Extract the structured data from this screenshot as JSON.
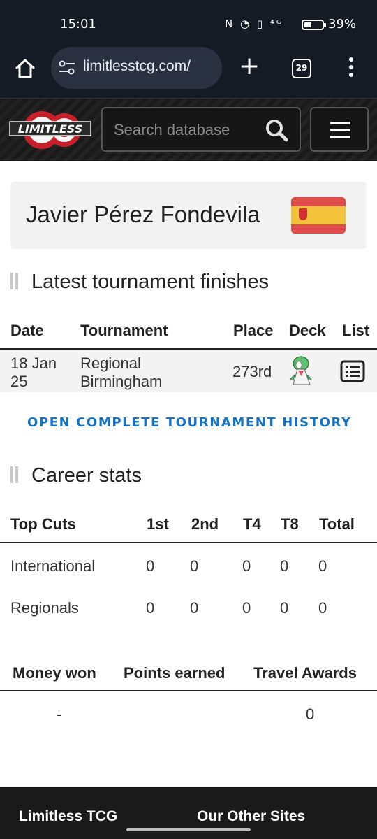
{
  "status_bar": {
    "time": "15:01",
    "icons_text": "N ◔ ▯ ⁴ᴳ",
    "battery": "39%"
  },
  "browser": {
    "url": "limitlesstcg.com/",
    "tab_count": "29"
  },
  "site": {
    "search_placeholder": "Search database",
    "logo_text": "LIMITLESS"
  },
  "player": {
    "name": "Javier Pérez Fondevila",
    "flag": "Spain"
  },
  "tournaments": {
    "title": "Latest tournament finishes",
    "headers": [
      "Date",
      "Tournament",
      "Place",
      "Deck",
      "List"
    ],
    "rows": [
      {
        "date_line1": "18 Jan",
        "date_line2": "25",
        "tournament_line1": "Regional",
        "tournament_line2": "Birmingham",
        "place": "273rd",
        "deck_icon": "gardevoir-sprite",
        "list_icon": "list-icon"
      }
    ],
    "history_link": "OPEN COMPLETE TOURNAMENT HISTORY"
  },
  "career": {
    "title": "Career stats",
    "headers": [
      "Top Cuts",
      "1st",
      "2nd",
      "T4",
      "T8",
      "Total"
    ],
    "rows": [
      {
        "label": "International",
        "first": "0",
        "second": "0",
        "t4": "0",
        "t8": "0",
        "total": "0"
      },
      {
        "label": "Regionals",
        "first": "0",
        "second": "0",
        "t4": "0",
        "t8": "0",
        "total": "0"
      }
    ],
    "money_headers": [
      "Money won",
      "Points earned",
      "Travel Awards"
    ],
    "money_values": {
      "money": "-",
      "points": "",
      "travel": "0"
    }
  },
  "footer": {
    "col1": "Limitless TCG",
    "col2": "Our Other Sites"
  },
  "colors": {
    "link": "#1473c4",
    "header_bg": "#151b25"
  }
}
